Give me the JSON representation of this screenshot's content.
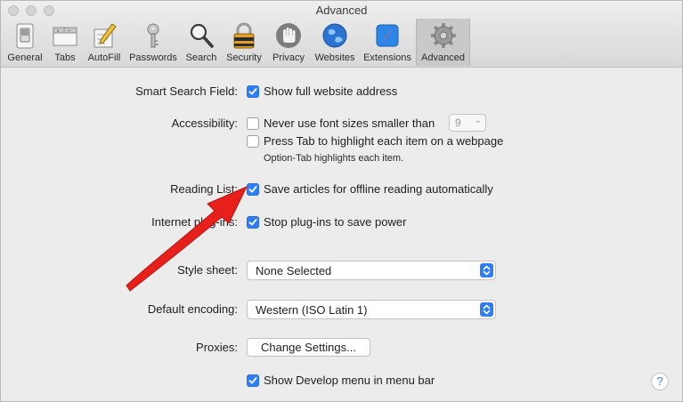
{
  "window": {
    "title": "Advanced"
  },
  "toolbar": {
    "tabs": [
      {
        "label": "General",
        "icon": "general-switch-icon"
      },
      {
        "label": "Tabs",
        "icon": "tabs-icon"
      },
      {
        "label": "AutoFill",
        "icon": "pencil-form-icon"
      },
      {
        "label": "Passwords",
        "icon": "key-icon"
      },
      {
        "label": "Search",
        "icon": "magnifier-icon"
      },
      {
        "label": "Security",
        "icon": "padlock-icon"
      },
      {
        "label": "Privacy",
        "icon": "hand-icon"
      },
      {
        "label": "Websites",
        "icon": "globe-icon"
      },
      {
        "label": "Extensions",
        "icon": "puzzle-compass-icon"
      },
      {
        "label": "Advanced",
        "icon": "gear-icon",
        "selected": true
      }
    ]
  },
  "settings": {
    "smart_search": {
      "label": "Smart Search Field:",
      "option": "Show full website address",
      "checked": true
    },
    "accessibility": {
      "label": "Accessibility:",
      "font_option": "Never use font sizes smaller than",
      "font_checked": false,
      "font_size_value": "9",
      "tab_option": "Press Tab to highlight each item on a webpage",
      "tab_checked": false,
      "note": "Option-Tab highlights each item."
    },
    "reading_list": {
      "label": "Reading List:",
      "option": "Save articles for offline reading automatically",
      "checked": true
    },
    "internet_plugins": {
      "label": "Internet plug-ins:",
      "option": "Stop plug-ins to save power",
      "checked": true
    },
    "style_sheet": {
      "label": "Style sheet:",
      "value": "None Selected"
    },
    "default_encoding": {
      "label": "Default encoding:",
      "value": "Western (ISO Latin 1)"
    },
    "proxies": {
      "label": "Proxies:",
      "button": "Change Settings..."
    },
    "develop_menu": {
      "option": "Show Develop menu in menu bar",
      "checked": true
    },
    "help": {
      "label": "?"
    }
  },
  "annotation": {
    "arrow_color": "#e8201c"
  },
  "colors": {
    "accent": "#2f7df6"
  }
}
